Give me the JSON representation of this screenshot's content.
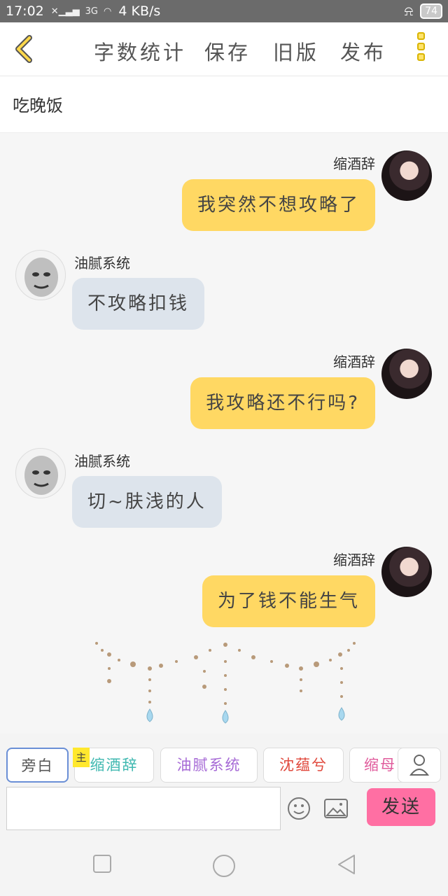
{
  "status_bar": {
    "time": "17:02",
    "network": "3G",
    "speed": "4 KB/s",
    "battery": "74"
  },
  "toolbar": {
    "back_icon": "chevron-left-icon",
    "word_count": "字数统计",
    "save": "保存",
    "old_version": "旧版",
    "publish": "发布",
    "more_icon": "more-vertical-icon"
  },
  "story": {
    "title": "吃晚饭"
  },
  "messages": [
    {
      "sender": "缩酒辞",
      "text": "我突然不想攻略了",
      "side": "right"
    },
    {
      "sender": "油腻系统",
      "text": "不攻略扣钱",
      "side": "left"
    },
    {
      "sender": "缩酒辞",
      "text": "我攻略还不行吗?",
      "side": "right"
    },
    {
      "sender": "油腻系统",
      "text": "切~肤浅的人",
      "side": "left"
    },
    {
      "sender": "缩酒辞",
      "text": "为了钱不能生气",
      "side": "right"
    }
  ],
  "roles": {
    "narrator": "旁白",
    "main_badge": "主",
    "items": [
      {
        "label": "缩酒辞",
        "color": "#3fb8b0"
      },
      {
        "label": "油腻系统",
        "color": "#a66ad6"
      },
      {
        "label": "沈蕴兮",
        "color": "#e0483c"
      },
      {
        "label": "缩母",
        "color": "#e05c9c"
      }
    ]
  },
  "composer": {
    "placeholder": "",
    "send": "发送",
    "emoji_icon": "smiley-icon",
    "image_icon": "image-icon"
  },
  "colors": {
    "accent_yellow": "#ffd863",
    "send_pink": "#ff6fa3",
    "received_bubble": "#dde4ec"
  }
}
